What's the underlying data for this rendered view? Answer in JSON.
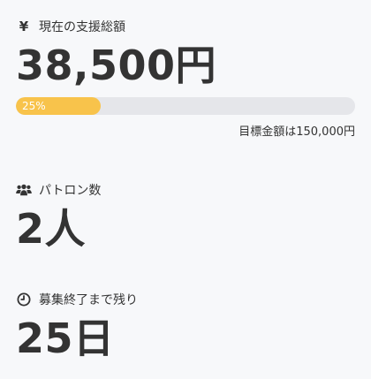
{
  "support": {
    "icon": "yen-icon",
    "icon_glyph": "¥",
    "label": "現在の支援総額",
    "amount": "38,500円",
    "progress_label": "25%",
    "progress_fraction": 0.25,
    "goal_text": "目標金額は150,000円",
    "progress_color": "#f8c34b",
    "track_color": "#e5e6ea"
  },
  "patrons": {
    "icon": "users-icon",
    "label": "パトロン数",
    "value": "2人"
  },
  "remaining": {
    "icon": "clock-icon",
    "label": "募集終了まで残り",
    "value": "25日"
  }
}
